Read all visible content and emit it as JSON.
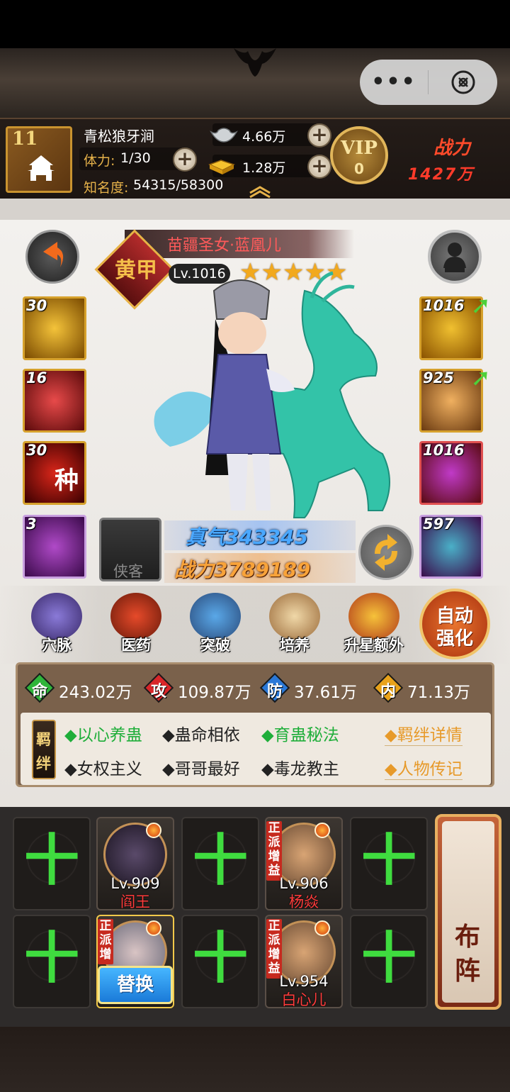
{
  "capsule": {
    "more_icon": "ellipsis-icon",
    "close_icon": "close-circle-icon"
  },
  "header": {
    "level": "11",
    "player_name": "青松狼牙涧",
    "stamina_label": "体力:",
    "stamina_value": "1/30",
    "fame_label": "知名度:",
    "fame_value": "54315/58300",
    "silver": "4.66万",
    "gold": "1.28万",
    "vip_label": "VIP",
    "vip_level": "0",
    "power_label": "战力",
    "power_value": "1427万"
  },
  "hero": {
    "rank_char": "黄甲",
    "name": "苗疆圣女·蓝凰儿",
    "level": "Lv.1016",
    "stars": 5,
    "zhenqi": "真气343345",
    "zhanli": "战力3789189",
    "helper_label": "侠客"
  },
  "left_slots": [
    {
      "count": "30",
      "mark": ""
    },
    {
      "count": "16",
      "mark": ""
    },
    {
      "count": "30",
      "mark": "种"
    },
    {
      "count": "3",
      "mark": ""
    }
  ],
  "right_slots": [
    {
      "count": "1016",
      "upgrade": true
    },
    {
      "count": "925",
      "upgrade": true
    },
    {
      "count": "1016",
      "upgrade": false
    },
    {
      "count": "597",
      "upgrade": false
    }
  ],
  "functions": [
    "穴脉",
    "医药",
    "突破",
    "培养",
    "升星额外"
  ],
  "auto_enhance": {
    "line1": "自动",
    "line2": "强化"
  },
  "attributes": [
    {
      "icon": "命",
      "value": "243.02万",
      "color": "#2fb53a"
    },
    {
      "icon": "攻",
      "value": "109.87万",
      "color": "#d8262a"
    },
    {
      "icon": "防",
      "value": "37.61万",
      "color": "#2a78d8"
    },
    {
      "icon": "内",
      "value": "71.13万",
      "color": "#e8a21a"
    }
  ],
  "bond_tag": [
    "羁",
    "绊"
  ],
  "bonds_row1": [
    {
      "text": "◆以心养蛊",
      "active": true
    },
    {
      "text": "◆蛊命相依",
      "active": false
    },
    {
      "text": "◆育蛊秘法",
      "active": true
    }
  ],
  "bonds_row2": [
    {
      "text": "◆女权主义",
      "active": false
    },
    {
      "text": "◆哥哥最好",
      "active": false
    },
    {
      "text": "◆毒龙教主",
      "active": false
    }
  ],
  "links": {
    "bond_detail": "◆羁绊详情",
    "biography": "◆人物传记"
  },
  "team": {
    "plus": "十",
    "heroes": [
      {
        "level": "Lv.909",
        "name": "阎王",
        "tag": ""
      },
      {
        "level": "Lv.906",
        "name": "杨焱",
        "tag": "正派增益"
      },
      {
        "level": "",
        "name": "",
        "tag": "正派增"
      },
      {
        "level": "Lv.954",
        "name": "白心儿",
        "tag": "正派增益"
      }
    ],
    "replace_label": "替换",
    "formation": [
      "布",
      "阵"
    ]
  }
}
